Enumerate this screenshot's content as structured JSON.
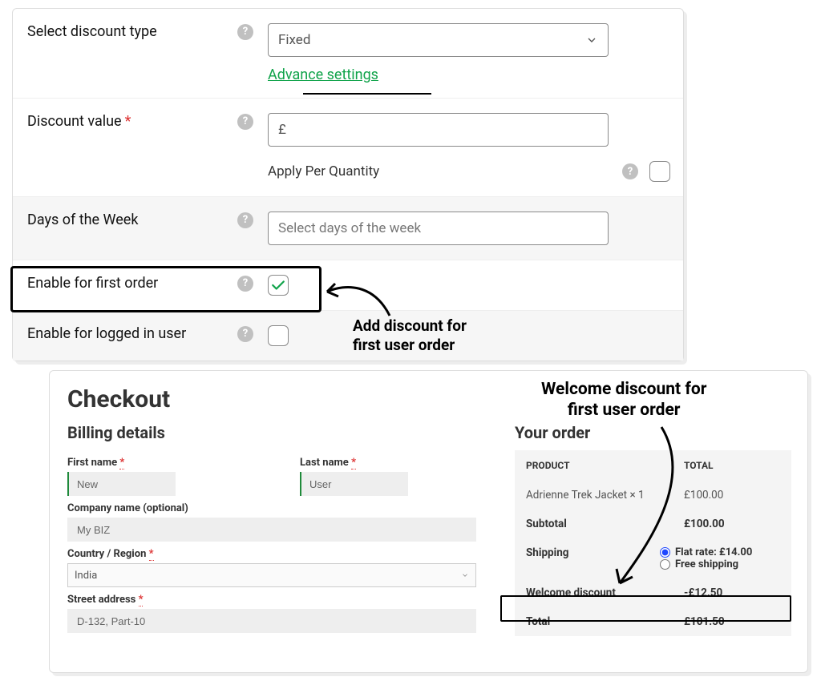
{
  "admin": {
    "discount_type_label": "Select discount type",
    "discount_type_value": "Fixed",
    "advance_settings": "Advance settings",
    "discount_value_label": "Discount value",
    "currency_prefix": "£",
    "apply_per_qty_label": "Apply Per Quantity",
    "days_label": "Days of the Week",
    "days_placeholder": "Select days of the week",
    "enable_first_label": "Enable for first order",
    "enable_first_checked": true,
    "enable_logged_label": "Enable for logged in user",
    "enable_logged_checked": false
  },
  "annotation1_line1": "Add discount for",
  "annotation1_line2": "first user order",
  "annotation2_line1": "Welcome discount for",
  "annotation2_line2": "first user order",
  "checkout": {
    "title": "Checkout",
    "billing_heading": "Billing details",
    "first_name_label": "First name",
    "last_name_label": "Last name",
    "company_label": "Company name (optional)",
    "country_label": "Country / Region",
    "street_label": "Street address",
    "first_name_value": "New",
    "last_name_value": "User",
    "company_value": "My BIZ",
    "country_value": "India",
    "street_value": "D-132, Part-10",
    "order_heading": "Your order",
    "table": {
      "col_product": "PRODUCT",
      "col_total": "TOTAL",
      "item_name": "Adrienne Trek Jacket",
      "item_qty": "× 1",
      "item_total": "£100.00",
      "subtotal_label": "Subtotal",
      "subtotal_value": "£100.00",
      "shipping_label": "Shipping",
      "shipping_flat": "Flat rate: £14.00",
      "shipping_free": "Free shipping",
      "welcome_label": "Welcome discount",
      "welcome_value": "-£12.50",
      "total_label": "Total",
      "total_value": "£101.50"
    }
  }
}
